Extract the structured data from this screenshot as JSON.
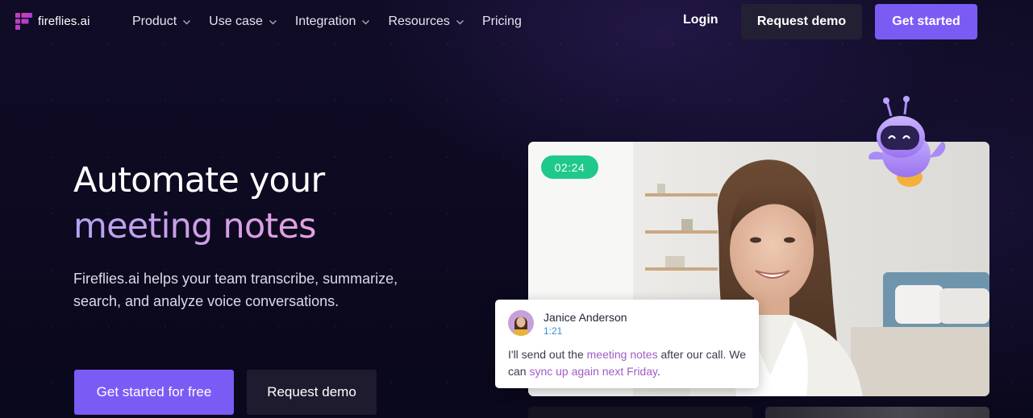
{
  "brand": {
    "logo_text": "fireflies.ai",
    "accent_color": "#7a5cf5",
    "background_color": "#0d0a22"
  },
  "nav": {
    "items": [
      {
        "label": "Product",
        "has_dropdown": true
      },
      {
        "label": "Use case",
        "has_dropdown": true
      },
      {
        "label": "Integration",
        "has_dropdown": true
      },
      {
        "label": "Resources",
        "has_dropdown": true
      },
      {
        "label": "Pricing",
        "has_dropdown": false
      }
    ],
    "login_label": "Login",
    "request_demo_label": "Request demo",
    "get_started_label": "Get started"
  },
  "hero": {
    "headline_line1": "Automate your",
    "headline_line2": "meeting notes",
    "subcopy": "Fireflies.ai helps your team transcribe, summarize, search, and analyze voice conversations.",
    "primary_cta": "Get started for free",
    "secondary_cta": "Request demo"
  },
  "video": {
    "timer": "02:24",
    "timer_color": "#1fc98b",
    "transcript": {
      "speaker_name": "Janice Anderson",
      "timestamp": "1:21",
      "segments": [
        {
          "text": "I'll send out the ",
          "highlight": false
        },
        {
          "text": "meeting notes",
          "highlight": true
        },
        {
          "text": " after our call. We can ",
          "highlight": false
        },
        {
          "text": "sync up again next Friday",
          "highlight": true
        },
        {
          "text": ".",
          "highlight": false
        }
      ],
      "highlight_color": "#a05bc8"
    }
  },
  "icons": {
    "logo": "fireflies-logo-icon",
    "dropdown": "chevron-down-icon",
    "mascot": "robot-mascot-icon"
  }
}
